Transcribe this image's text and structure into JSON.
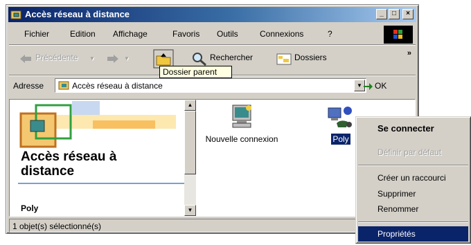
{
  "window": {
    "title": "Accès réseau à distance"
  },
  "menubar": {
    "items": [
      "Fichier",
      "Edition",
      "Affichage",
      "Favoris",
      "Outils",
      "Connexions",
      "?"
    ]
  },
  "toolbar": {
    "back_label": "Précédente",
    "search_label": "Rechercher",
    "folders_label": "Dossiers",
    "overflow": "»"
  },
  "tooltip": {
    "text": "Dossier parent"
  },
  "address": {
    "label": "Adresse",
    "value": "Accès réseau à distance",
    "go_label": "OK"
  },
  "left_pane": {
    "title": "Accès réseau à distance",
    "selected_item": "Poly"
  },
  "files": [
    {
      "label": "Nouvelle connexion",
      "icon": "new-connection-icon",
      "selected": false
    },
    {
      "label": "Poly",
      "icon": "dialup-connection-icon",
      "selected": true
    }
  ],
  "status": {
    "text": "1 objet(s) sélectionné(s)"
  },
  "context_menu": {
    "items": [
      {
        "label": "Se connecter",
        "state": "default"
      },
      {
        "label": "Définir par défaut",
        "state": "disabled"
      },
      {
        "label": "Créer un raccourci",
        "state": "normal"
      },
      {
        "label": "Supprimer",
        "state": "normal"
      },
      {
        "label": "Renommer",
        "state": "normal"
      },
      {
        "label": "Propriétés",
        "state": "highlighted"
      }
    ]
  },
  "colors": {
    "titlebar_start": "#0a246a",
    "titlebar_end": "#a6caf0",
    "selection": "#0a246a",
    "face": "#d4d0c8"
  }
}
